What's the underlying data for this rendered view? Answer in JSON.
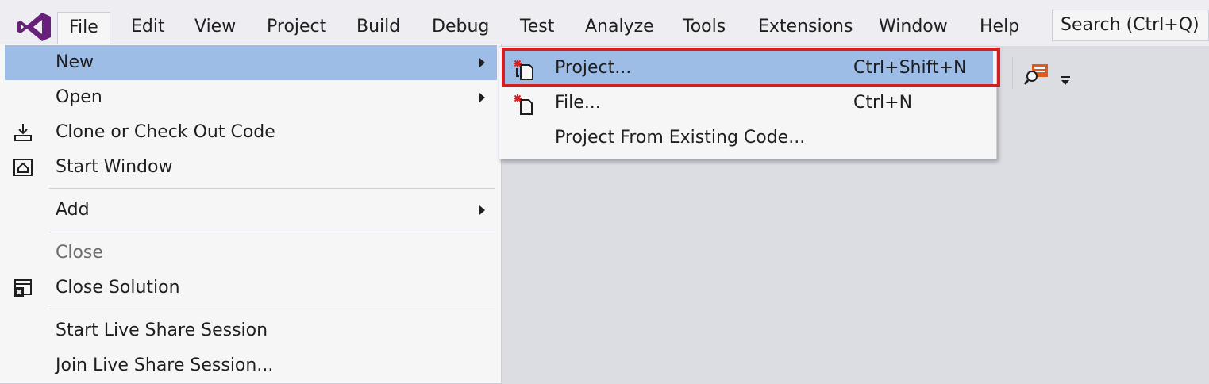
{
  "app": {
    "logo_icon": "visual-studio-logo-icon",
    "accent_color": "#68217a"
  },
  "menubar": {
    "items": [
      "File",
      "Edit",
      "View",
      "Project",
      "Build",
      "Debug",
      "Test",
      "Analyze",
      "Tools",
      "Extensions",
      "Window",
      "Help"
    ],
    "active": "File"
  },
  "search": {
    "placeholder": "Search (Ctrl+Q)"
  },
  "file_menu": {
    "items": [
      {
        "label": "New",
        "has_submenu": true,
        "highlighted": true
      },
      {
        "label": "Open",
        "has_submenu": true
      },
      {
        "label": "Clone or Check Out Code",
        "icon": "clone-download-icon"
      },
      {
        "label": "Start Window",
        "icon": "start-window-icon"
      },
      {
        "label": "Add",
        "has_submenu": true
      },
      {
        "label": "Close",
        "disabled": true
      },
      {
        "label": "Close Solution",
        "icon": "close-solution-icon"
      },
      {
        "label": "Start Live Share Session"
      },
      {
        "label": "Join Live Share Session..."
      }
    ]
  },
  "new_submenu": {
    "items": [
      {
        "label": "Project...",
        "shortcut": "Ctrl+Shift+N",
        "icon": "new-project-icon",
        "highlighted": true
      },
      {
        "label": "File...",
        "shortcut": "Ctrl+N",
        "icon": "new-file-icon"
      },
      {
        "label": "Project From Existing Code..."
      }
    ]
  },
  "colors": {
    "menu_hover": "#9ebde6",
    "annotation_box": "#d31f1f",
    "workspace": "#dcdde3"
  }
}
